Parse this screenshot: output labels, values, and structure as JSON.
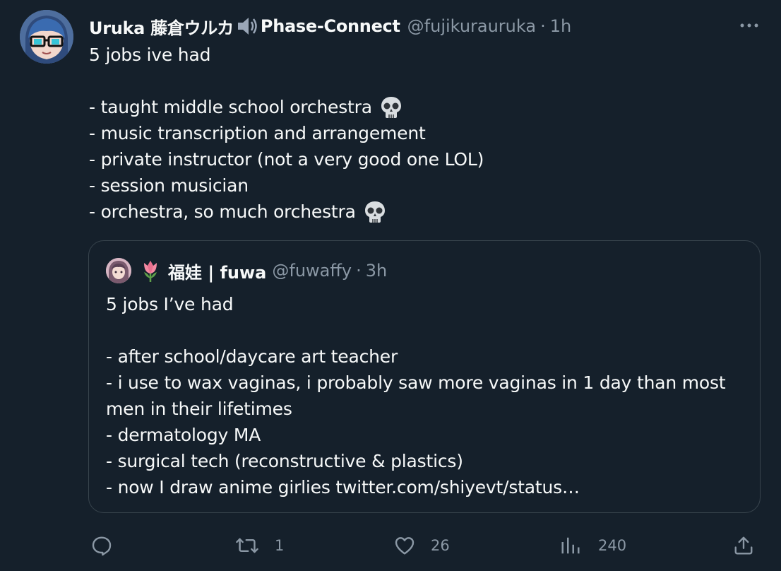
{
  "tweet": {
    "author_name": "Uruka 藤倉ウルカ",
    "author_name_suffix": "Phase-Connect",
    "handle": "@fujikurauruka",
    "separator": "·",
    "time": "1h",
    "text_lines": [
      "5 jobs ive had",
      "",
      "- taught middle school orchestra",
      "- music transcription and arrangement",
      "- private instructor (not a very good one LOL)",
      "- session musician",
      "- orchestra, so much orchestra"
    ],
    "icons": {
      "speaker": "speaker-icon",
      "skull": "skull-emoji",
      "more": "more-icon"
    }
  },
  "quote": {
    "author_name": "福娃 | fuwa",
    "handle": "@fuwaffy",
    "separator": "·",
    "time": "3h",
    "text_lines": [
      "5 jobs I’ve had",
      "",
      "- after school/daycare art teacher",
      "- i use to wax vaginas, i probably saw more vaginas in 1 day than most",
      "men in their lifetimes",
      "- dermatology MA",
      "- surgical tech (reconstructive & plastics)",
      "- now I draw anime girlies twitter.com/shiyevt/status…"
    ],
    "icons": {
      "tulip": "tulip-emoji"
    }
  },
  "actions": {
    "reply": {
      "icon": "reply-icon",
      "count": ""
    },
    "retweet": {
      "icon": "retweet-icon",
      "count": "1"
    },
    "like": {
      "icon": "heart-icon",
      "count": "26"
    },
    "views": {
      "icon": "analytics-icon",
      "count": "240"
    },
    "share": {
      "icon": "share-icon",
      "count": ""
    }
  },
  "colors": {
    "background": "#15202b",
    "text_primary": "#f7f9f9",
    "text_secondary": "#8b98a5",
    "border": "#38444d"
  }
}
